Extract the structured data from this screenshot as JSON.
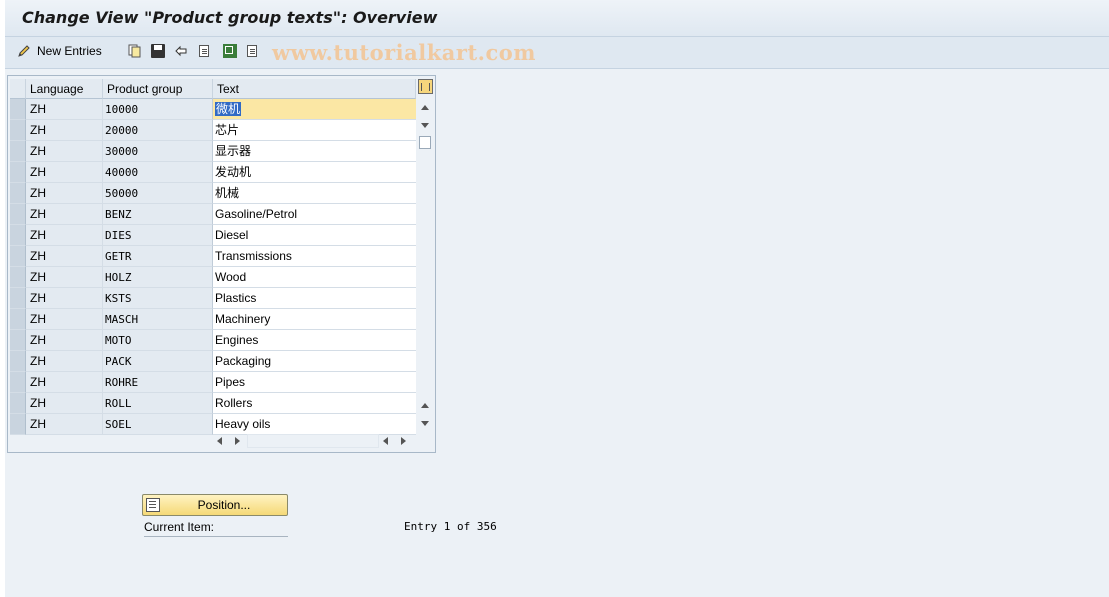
{
  "window": {
    "title": "Change View \"Product group texts\": Overview"
  },
  "toolbar": {
    "new_entries_label": "New Entries",
    "icons": [
      "display-change-icon",
      "copy-icon",
      "delete-icon",
      "undo-icon",
      "select-all-icon",
      "select-block-icon",
      "deselect-all-icon"
    ]
  },
  "watermark": "www.tutorialkart.com",
  "table": {
    "headers": {
      "language": "Language",
      "product_group": "Product group",
      "text": "Text"
    },
    "rows": [
      {
        "language": "ZH",
        "product_group": "10000",
        "text": "微机"
      },
      {
        "language": "ZH",
        "product_group": "20000",
        "text": "芯片"
      },
      {
        "language": "ZH",
        "product_group": "30000",
        "text": "显示器"
      },
      {
        "language": "ZH",
        "product_group": "40000",
        "text": "发动机"
      },
      {
        "language": "ZH",
        "product_group": "50000",
        "text": "机械"
      },
      {
        "language": "ZH",
        "product_group": "BENZ",
        "text": "Gasoline/Petrol"
      },
      {
        "language": "ZH",
        "product_group": "DIES",
        "text": "Diesel"
      },
      {
        "language": "ZH",
        "product_group": "GETR",
        "text": "Transmissions"
      },
      {
        "language": "ZH",
        "product_group": "HOLZ",
        "text": "Wood"
      },
      {
        "language": "ZH",
        "product_group": "KSTS",
        "text": "Plastics"
      },
      {
        "language": "ZH",
        "product_group": "MASCH",
        "text": "Machinery"
      },
      {
        "language": "ZH",
        "product_group": "MOTO",
        "text": "Engines"
      },
      {
        "language": "ZH",
        "product_group": "PACK",
        "text": "Packaging"
      },
      {
        "language": "ZH",
        "product_group": "ROHRE",
        "text": "Pipes"
      },
      {
        "language": "ZH",
        "product_group": "ROLL",
        "text": "Rollers"
      },
      {
        "language": "ZH",
        "product_group": "SOEL",
        "text": "Heavy oils"
      }
    ]
  },
  "footer": {
    "position_button_label": "Position...",
    "current_item_label": "Current Item:",
    "entry_info": "Entry 1 of 356"
  },
  "colors": {
    "title_bar": "#dfe8f1",
    "selected_row": "#fbe7a4",
    "button": "#f5d977",
    "watermark": "#f0c9a0"
  }
}
